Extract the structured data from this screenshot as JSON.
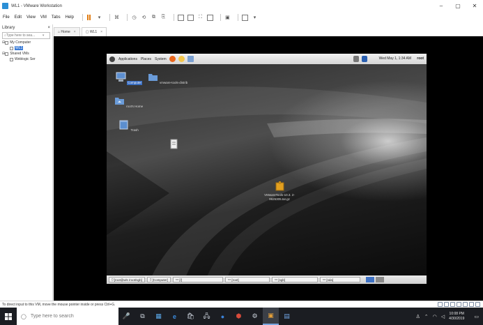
{
  "window": {
    "title": "WL1 - VMware Workstation",
    "controls": [
      "–",
      "▢",
      "✕"
    ]
  },
  "menu": [
    "File",
    "Edit",
    "View",
    "VM",
    "Tabs",
    "Help"
  ],
  "library": {
    "title": "Library",
    "close": "×",
    "search_placeholder": "Type here to sea...",
    "tree": {
      "my_computer": "My Computer",
      "vm": "WL1",
      "shared_vms": "Shared VMs",
      "weblogic": "Weblogic Ser"
    }
  },
  "tabs": [
    {
      "label": "Home",
      "close": "×"
    },
    {
      "label": "WL1",
      "close": "×"
    }
  ],
  "guest": {
    "menus": [
      "Applications",
      "Places",
      "System"
    ],
    "clock": "Wed May 1, 1:34 AM",
    "user": "root",
    "desktop_icons": {
      "computer": "Computer",
      "vmware_tools": "vmware-tools-distrib",
      "home": "root's Home",
      "trash": "Trash",
      "file": "",
      "tar": "VMwareTools-10.3. 2-9925305.tar.gz"
    },
    "panel_tasks": [
      "[root@wls /root/sgb]",
      "[Computer]",
      "[/]",
      "[root]",
      "[sgb]",
      "[sda]"
    ]
  },
  "status": {
    "message": "To direct input to this VM, move the mouse pointer inside or press Ctrl+G."
  },
  "taskbar": {
    "search_placeholder": "Type here to search",
    "apps": [
      "🎤",
      "⧉",
      "▦",
      "e",
      "🛍",
      "🖧",
      "●",
      "⬢",
      "⚙",
      "▣",
      "▤"
    ],
    "time": "10:08 PM",
    "date": "4/30/2019"
  },
  "colors": {
    "vmware_blue": "#2b8fd6",
    "selection": "#3a7bd5",
    "pause_orange": "#e07a10",
    "taskbar": "#1b1d22"
  }
}
